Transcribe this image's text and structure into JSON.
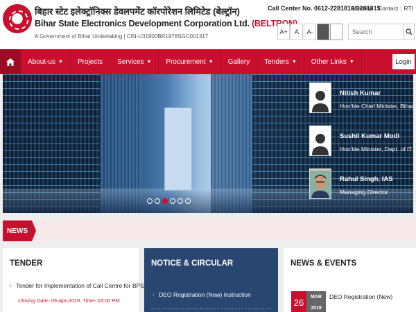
{
  "header": {
    "org_name_hindi": "बिहार स्टेट इलेक्ट्रॉनिक्स डेवलपमेंट कॉरपोरेशन लिमिटेड (बेल्ट्रॉन)",
    "org_name_english": "Bihar State Electronics Development Corporation Ltd.",
    "org_acronym": "(BELTRON)",
    "subtitle": "A Government of Bihar Undertaking  |  CIN-U31900BR1978SGC001317",
    "call_center": "Call Center No. 0612-2281814/2281815",
    "top_links": [
      "Sitemap",
      "Contact",
      "RTI"
    ],
    "font_buttons": [
      "A+",
      "A",
      "A-"
    ],
    "theme_colors": [
      "#555555",
      "#ffffff"
    ],
    "search_placeholder": "Search"
  },
  "nav": {
    "items": [
      {
        "label": "About-us",
        "caret": true
      },
      {
        "label": "Projects",
        "caret": false
      },
      {
        "label": "Services",
        "caret": true
      },
      {
        "label": "Procurement",
        "caret": true
      },
      {
        "label": "Gallery",
        "caret": false
      },
      {
        "label": "Tenders",
        "caret": true
      },
      {
        "label": "Other Links",
        "caret": true
      }
    ],
    "login_label": "Login",
    "accent_color": "#c8102e"
  },
  "slider": {
    "active_index": 2,
    "count": 6
  },
  "people": [
    {
      "name": "Nitish Kumar",
      "role": "Hon'ble Chief Minister, Bihar",
      "photo": "placeholder"
    },
    {
      "name": "Sushil Kumar Modi",
      "role": "Hon'ble Minister, Dept. of IT",
      "photo": "placeholder"
    },
    {
      "name": "Rahul Singh, IAS",
      "role": "Managing Director",
      "photo": "photo"
    }
  ],
  "news_ticker": {
    "label": "NEWS"
  },
  "tender": {
    "title": "TENDER",
    "items": [
      {
        "text": "Tender for Implementation of Call Centre for BPSM",
        "closing": "Closing Date- 05-Apr-2019, Time- 03:00 PM"
      }
    ]
  },
  "notice": {
    "title": "NOTICE & CIRCULAR",
    "items": [
      {
        "text": "DEO Registration (New) Instruction"
      }
    ]
  },
  "events": {
    "title": "NEWS & EVENTS",
    "items": [
      {
        "day": "26",
        "month": "MAR",
        "year": "2019",
        "text": "DEO Registration (New)"
      }
    ]
  }
}
